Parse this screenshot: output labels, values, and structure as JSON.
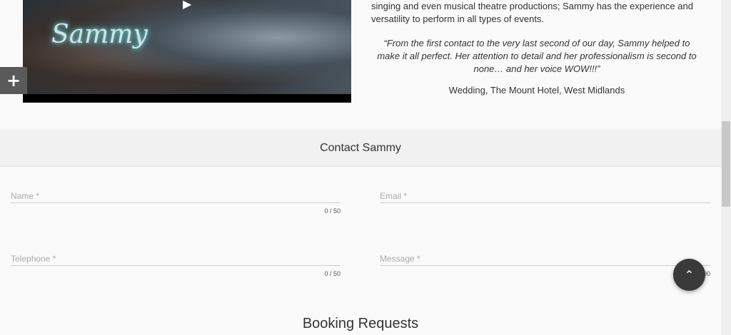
{
  "video": {
    "watermark": "Sammy",
    "play_icon": "play-icon"
  },
  "plus_button": {
    "label": "+"
  },
  "bio": {
    "line1": "singing and even musical theatre productions; Sammy has the experience and",
    "line2": "versatility to perform in all types of events."
  },
  "testimonial": {
    "quote_line1": "“From the first contact to the very last second of our day, Sammy helped to",
    "quote_line2": "make it all perfect. Her attention to detail and her professionalism is second to",
    "quote_line3": "none… and her voice WOW!!!”",
    "source": "Wedding, The Mount Hotel, West Midlands"
  },
  "contact": {
    "title": "Contact Sammy",
    "fields": {
      "name": {
        "placeholder": "Name *",
        "counter": "0 / 50"
      },
      "email": {
        "placeholder": "Email *"
      },
      "telephone": {
        "placeholder": "Telephone *",
        "counter": "0 / 50"
      },
      "message": {
        "placeholder": "Message *",
        "counter": "0 / 500"
      }
    }
  },
  "booking": {
    "title": "Booking Requests"
  },
  "back_to_top": {
    "icon": "chevron-up-icon",
    "glyph": "⌃"
  }
}
